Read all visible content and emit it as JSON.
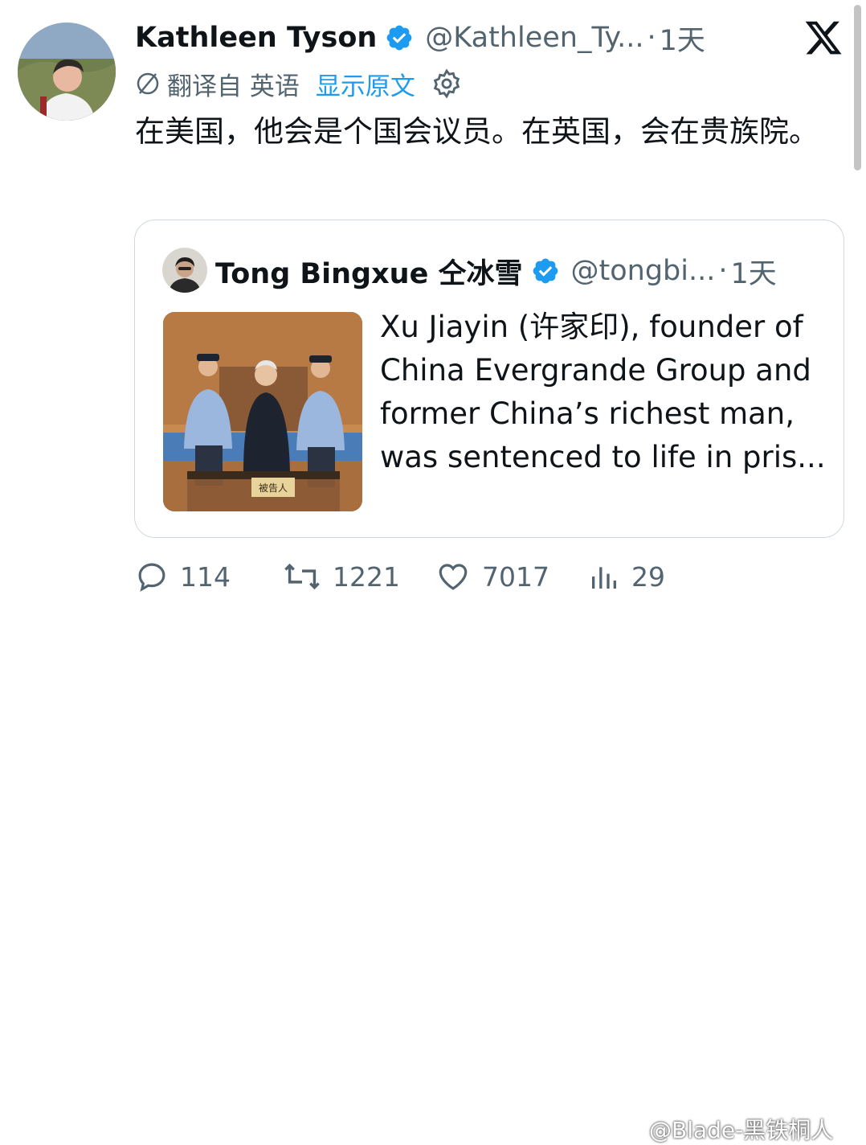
{
  "tweet": {
    "author_name": "Kathleen Tyson",
    "author_handle": "@Kathleen_Ty...",
    "separator": "·",
    "time": "1天",
    "translated_from": "翻译自 英语",
    "show_original": "显示原文",
    "text": "在美国，他会是个国会议员。在英国，会在贵族院。"
  },
  "quote": {
    "author_name": "Tong Bingxue 仝冰雪",
    "author_handle": "@tongbi...",
    "separator": "·",
    "time": "1天",
    "text": "Xu Jiayin (许家印), founder of China Evergrande Group and former China’s richest man, was sentenced to life in pris...",
    "image_sign": "被告人"
  },
  "actions": {
    "replies": "114",
    "retweets": "1221",
    "likes": "7017",
    "views": "29"
  },
  "watermark": "@Blade-黑铁桐人",
  "colors": {
    "verified_blue": "#1d9bf0",
    "secondary_text": "#536471",
    "border": "#cfd9de"
  },
  "icons": [
    "verified-badge-icon",
    "x-logo-icon",
    "translate-icon",
    "gear-icon",
    "reply-icon",
    "retweet-icon",
    "like-icon",
    "views-icon"
  ]
}
